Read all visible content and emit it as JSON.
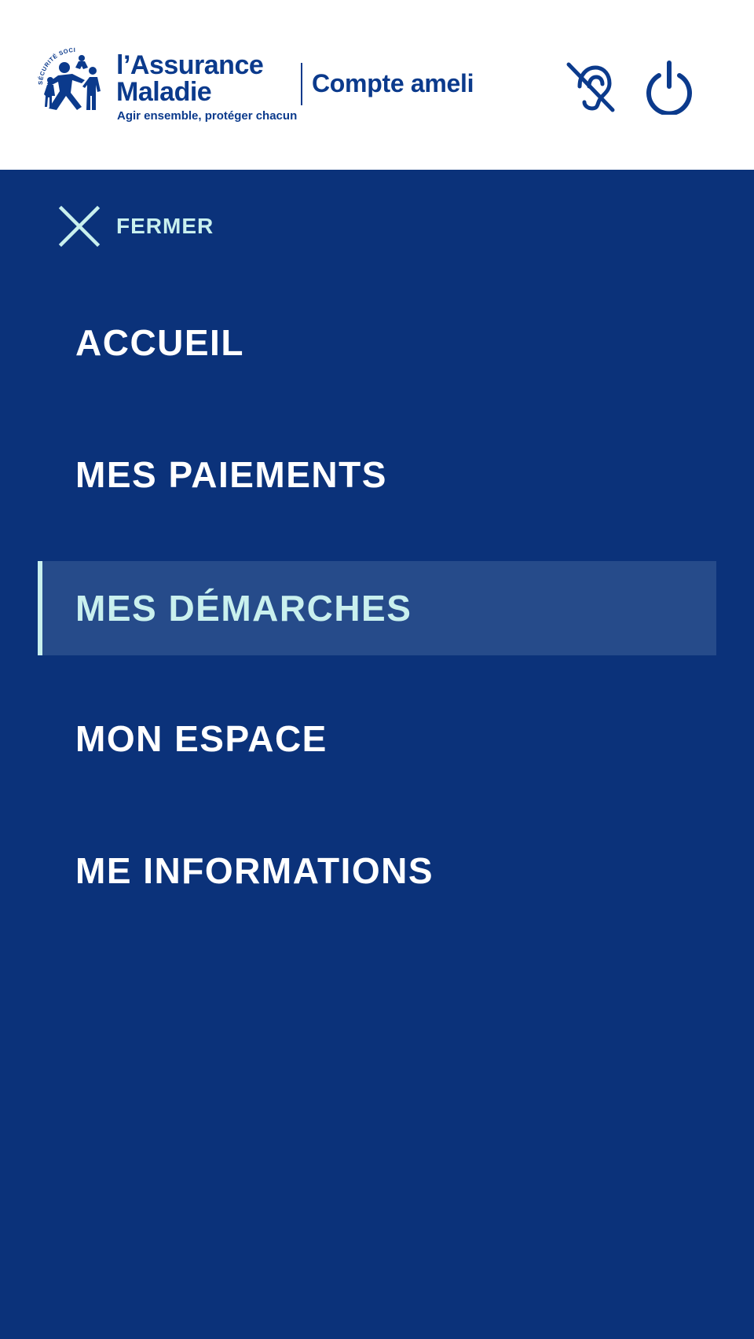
{
  "header": {
    "logo": {
      "arc_text": "SÉCURITÉ SOCIALE",
      "title_line1": "l’Assurance",
      "title_line2": "Maladie",
      "tagline": "Agir ensemble, protéger chacun"
    },
    "app_name": "Compte ameli",
    "accessibility_icon": "hearing-impaired-icon",
    "power_icon": "power-icon"
  },
  "menu": {
    "close_icon": "close-icon",
    "close_label": "FERMER",
    "items": [
      {
        "label": "ACCUEIL",
        "active": false
      },
      {
        "label": "MES PAIEMENTS",
        "active": false
      },
      {
        "label": "MES DÉMARCHES",
        "active": true
      },
      {
        "label": "MON ESPACE",
        "active": false
      },
      {
        "label": "ME INFORMATIONS",
        "active": false
      }
    ]
  },
  "colors": {
    "brand_blue": "#0b3a8c",
    "menu_background": "#0b327a",
    "active_background": "#264b8a",
    "accent_mint": "#c9f0ee",
    "header_background": "#ffffff"
  }
}
